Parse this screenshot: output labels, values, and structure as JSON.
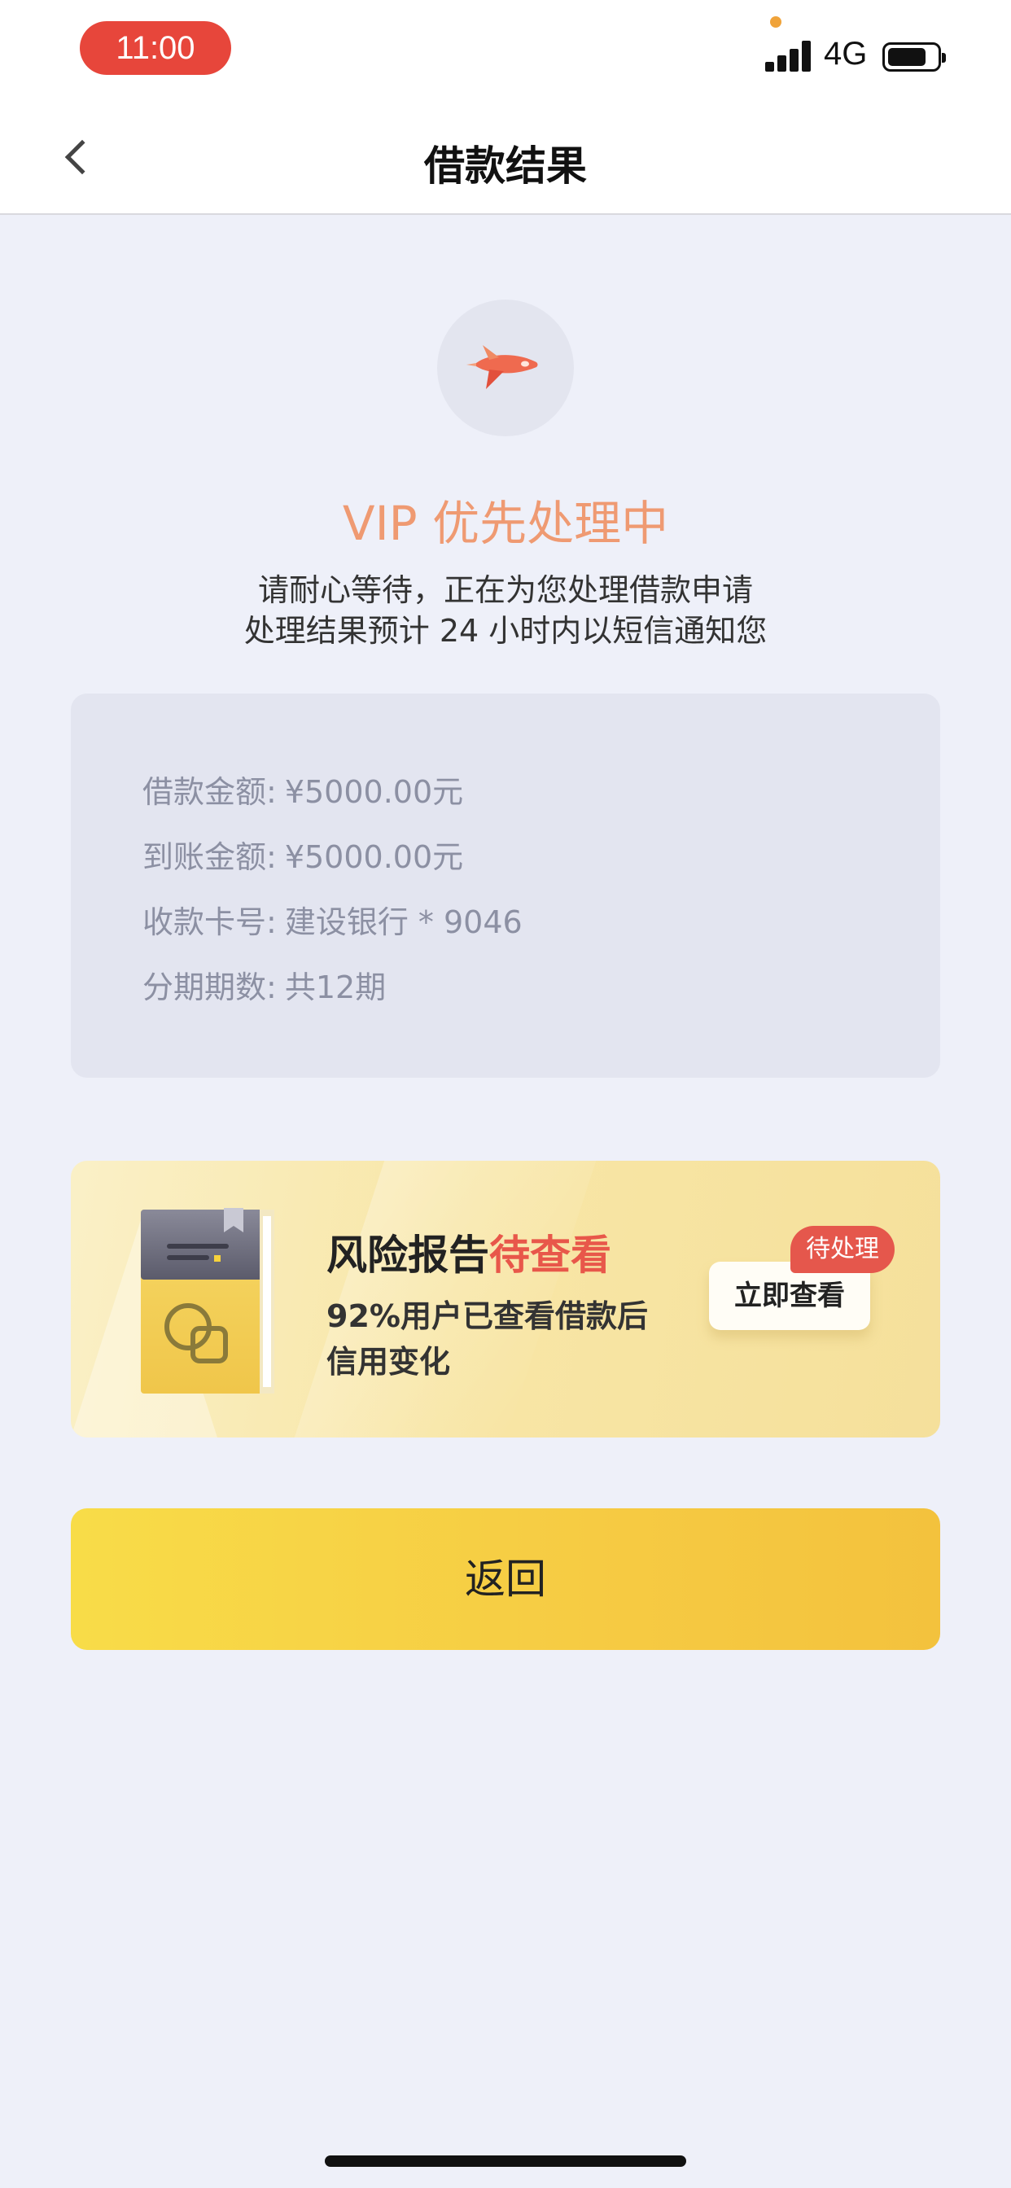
{
  "status_bar": {
    "time": "11:00",
    "network": "4G",
    "signal_bars": 4,
    "battery_level": 0.8
  },
  "header": {
    "title": "借款结果",
    "back_icon": "chevron-left-icon"
  },
  "result": {
    "icon": "rocket-icon",
    "title": "VIP 优先处理中",
    "desc_line1": "请耐心等待，正在为您处理借款申请",
    "desc_line2": "处理结果预计 24 小时内以短信通知您"
  },
  "loan_info": {
    "rows": [
      {
        "label": "借款金额:",
        "value": "¥5000.00元"
      },
      {
        "label": "到账金额:",
        "value": "¥5000.00元"
      },
      {
        "label": "收款卡号:",
        "value": "建设银行 * 9046"
      },
      {
        "label": "分期期数:",
        "value": "共12期"
      }
    ]
  },
  "promo": {
    "title_main": "风险报告",
    "title_highlight": "待查看",
    "sub_line1": "92%用户已查看借款后",
    "sub_line2": "信用变化",
    "button_label": "立即查看",
    "badge": "待处理"
  },
  "actions": {
    "return_label": "返回"
  },
  "colors": {
    "accent_red": "#e7463b",
    "title_orange": "#ef9a72",
    "button_yellow": "#f6cb43",
    "info_text": "#8c90a3",
    "background": "#eef0f9"
  }
}
